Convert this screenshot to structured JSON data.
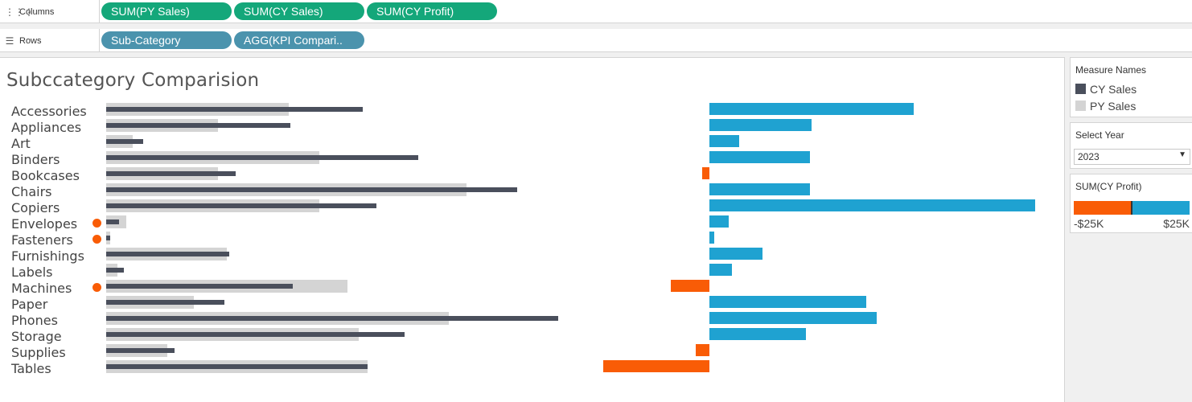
{
  "shelves": {
    "columns": {
      "label": "Columns",
      "icon": "columns-icon",
      "pills": [
        "SUM(PY Sales)",
        "SUM(CY Sales)",
        "SUM(CY Profit)"
      ]
    },
    "rows": {
      "label": "Rows",
      "icon": "rows-icon",
      "pills": [
        "Sub-Category",
        "AGG(KPI Compari.."
      ]
    }
  },
  "view": {
    "title": "Subccategory Comparision"
  },
  "colors": {
    "py_sales": "#d4d4d4",
    "cy_sales": "#4a4f5c",
    "profit_positive": "#1fa2d1",
    "profit_negative": "#f95c06",
    "kpi_marker": "#f95c06",
    "pill_measure": "#14a77a",
    "pill_dimension": "#4b93ad"
  },
  "legend": {
    "title": "Measure Names",
    "items": [
      {
        "label": "CY Sales",
        "color": "#4a4f5c"
      },
      {
        "label": "PY Sales",
        "color": "#d4d4d4"
      }
    ]
  },
  "filter": {
    "title": "Select Year",
    "value": "2023"
  },
  "profit_legend": {
    "title": "SUM(CY Profit)",
    "min_label": "-$25K",
    "max_label": "$25K"
  },
  "chart_data": {
    "type": "bar",
    "categories": [
      "Accessories",
      "Appliances",
      "Art",
      "Binders",
      "Bookcases",
      "Chairs",
      "Copiers",
      "Envelopes",
      "Fasteners",
      "Furnishings",
      "Labels",
      "Machines",
      "Paper",
      "Phones",
      "Storage",
      "Supplies",
      "Tables"
    ],
    "kpi_flag": [
      false,
      false,
      false,
      false,
      false,
      false,
      false,
      true,
      true,
      false,
      false,
      true,
      false,
      false,
      false,
      false,
      false
    ],
    "series": [
      {
        "name": "PY Sales",
        "values": [
          83,
          51,
          12,
          97,
          51,
          164,
          97,
          9,
          2,
          55,
          5,
          110,
          40,
          156,
          115,
          28,
          119
        ]
      },
      {
        "name": "CY Sales",
        "values": [
          117,
          84,
          17,
          142,
          59,
          187,
          123,
          6,
          2,
          56,
          8,
          85,
          54,
          206,
          136,
          31,
          119
        ]
      },
      {
        "name": "CY Profit",
        "values": [
          13.8,
          6.9,
          2.0,
          6.8,
          -0.5,
          6.8,
          22.0,
          1.3,
          0.3,
          3.6,
          1.5,
          -2.6,
          10.6,
          11.3,
          6.5,
          -0.9,
          -7.2
        ]
      }
    ]
  }
}
